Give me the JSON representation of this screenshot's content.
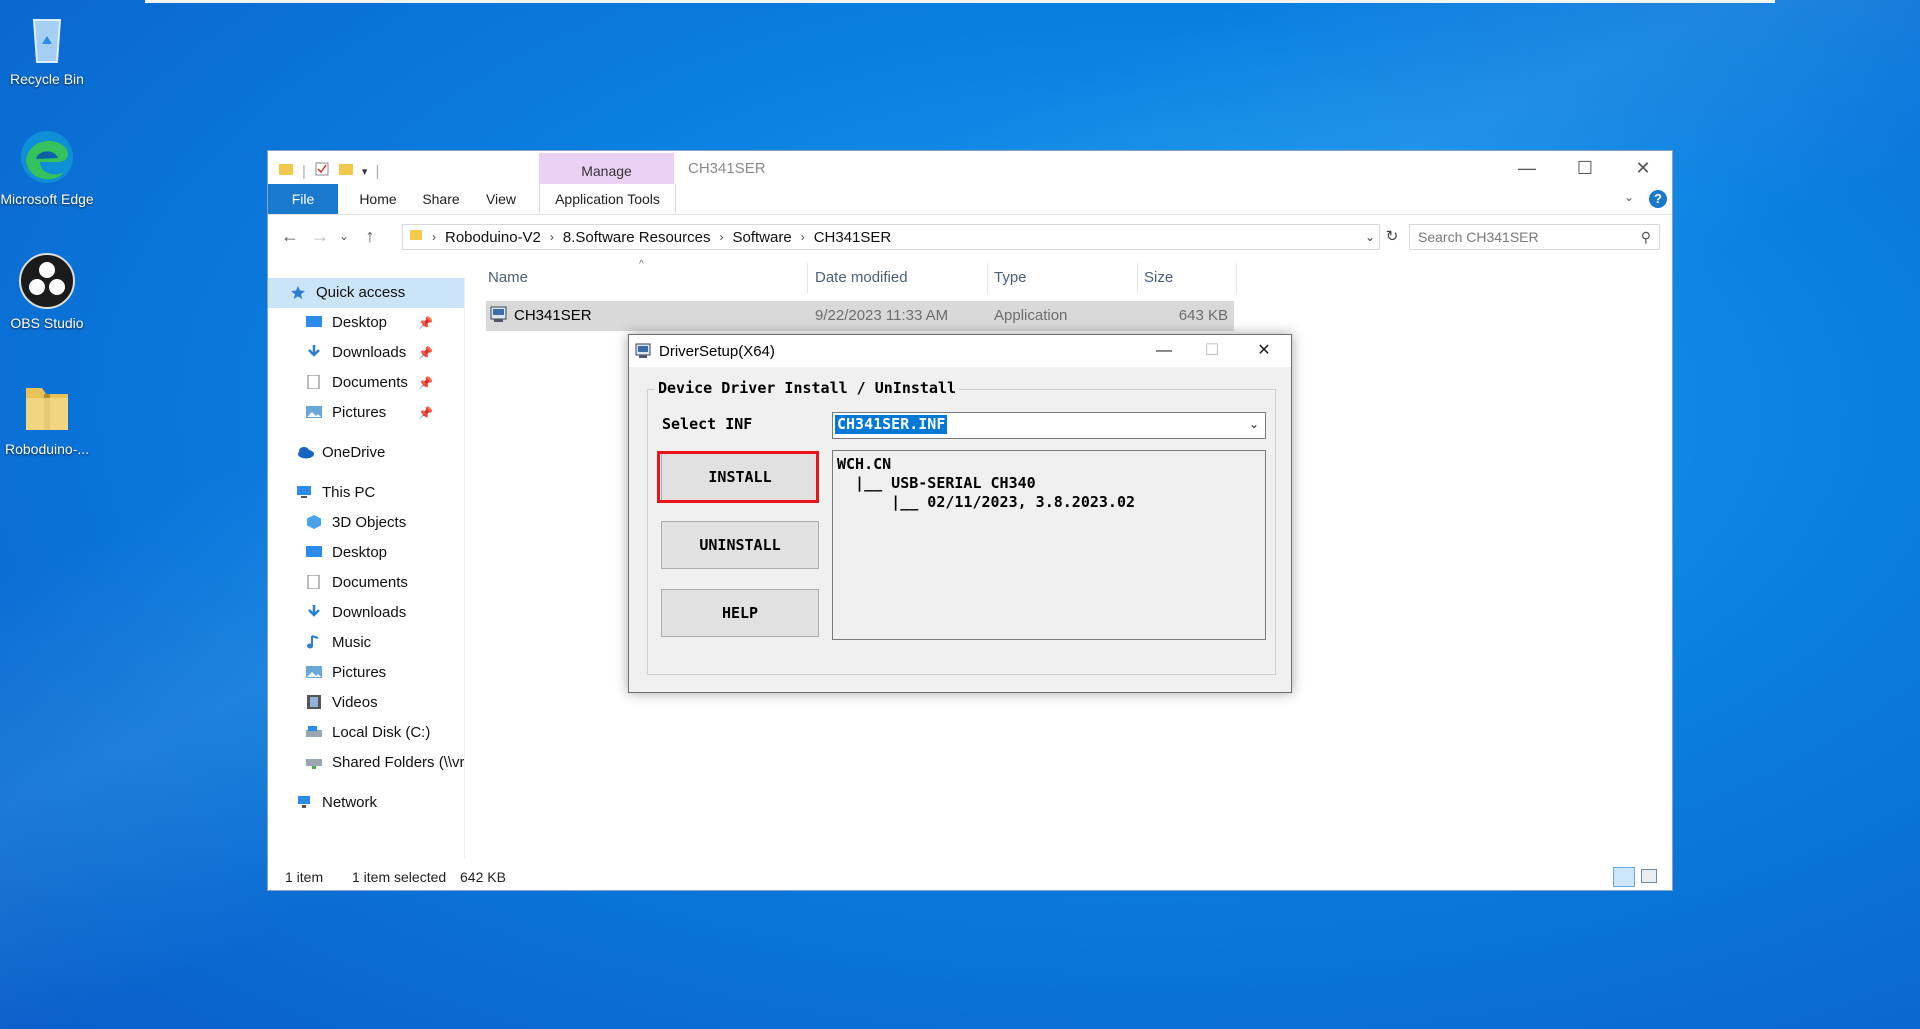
{
  "desktop": {
    "icons": [
      {
        "label": "Recycle Bin"
      },
      {
        "label": "Microsoft Edge"
      },
      {
        "label": "OBS Studio"
      },
      {
        "label": "Roboduino-..."
      }
    ]
  },
  "explorer": {
    "title": "CH341SER",
    "manage_tab": "Manage",
    "ribbon_tabs": [
      "File",
      "Home",
      "Share",
      "View",
      "Application Tools"
    ],
    "breadcrumb": [
      "Roboduino-V2",
      "8.Software Resources",
      "Software",
      "CH341SER"
    ],
    "search_placeholder": "Search CH341SER",
    "nav": {
      "quick_access": "Quick access",
      "quick_items": [
        "Desktop",
        "Downloads",
        "Documents",
        "Pictures"
      ],
      "onedrive": "OneDrive",
      "this_pc": "This PC",
      "pc_items": [
        "3D Objects",
        "Desktop",
        "Documents",
        "Downloads",
        "Music",
        "Pictures",
        "Videos",
        "Local Disk (C:)",
        "Shared Folders (\\\\vr"
      ],
      "network": "Network"
    },
    "columns": [
      "Name",
      "Date modified",
      "Type",
      "Size"
    ],
    "files": [
      {
        "name": "CH341SER",
        "date": "9/22/2023 11:33 AM",
        "type": "Application",
        "size": "643 KB"
      }
    ],
    "status": {
      "count": "1 item",
      "selected": "1 item selected",
      "size": "642 KB"
    }
  },
  "dialog": {
    "title": "DriverSetup(X64)",
    "group_label": "Device Driver Install / UnInstall",
    "select_label": "Select INF",
    "inf_value": "CH341SER.INF",
    "buttons": {
      "install": "INSTALL",
      "uninstall": "UNINSTALL",
      "help": "HELP"
    },
    "info_lines": [
      "WCH.CN",
      "  |__ USB-SERIAL CH340",
      "      |__ 02/11/2023, 3.8.2023.02"
    ],
    "highlight_color": "#e8141a"
  }
}
